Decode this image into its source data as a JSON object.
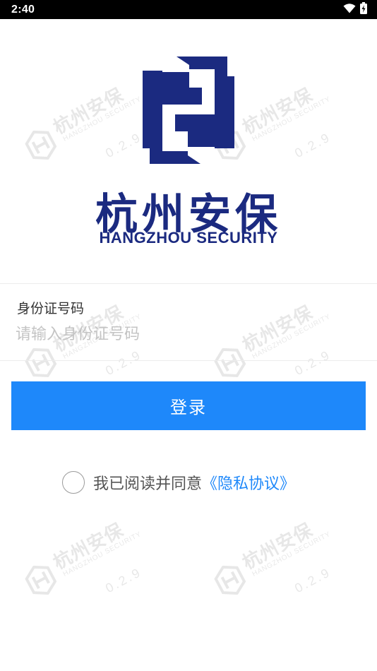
{
  "status_bar": {
    "time": "2:40",
    "icons": [
      "wifi-icon",
      "battery-charging-icon"
    ]
  },
  "brand": {
    "logo_icon": "hs-shield-logo-icon",
    "name_cn": "杭州安保",
    "name_en": "HANGZHOU SECURITY",
    "color": "#1b2a80"
  },
  "watermark": {
    "name_cn": "杭州安保",
    "name_en": "HANGZHOU SECURITY",
    "version": "0.2.9"
  },
  "form": {
    "id_label": "身份证号码",
    "id_value": "",
    "id_placeholder": "请输入身份证号码"
  },
  "login_button": {
    "label": "登录",
    "color": "#1e88fa"
  },
  "agreement": {
    "checked": false,
    "text": "我已阅读并同意",
    "link_text": "《隐私协议》",
    "link_color": "#1e88fa"
  }
}
